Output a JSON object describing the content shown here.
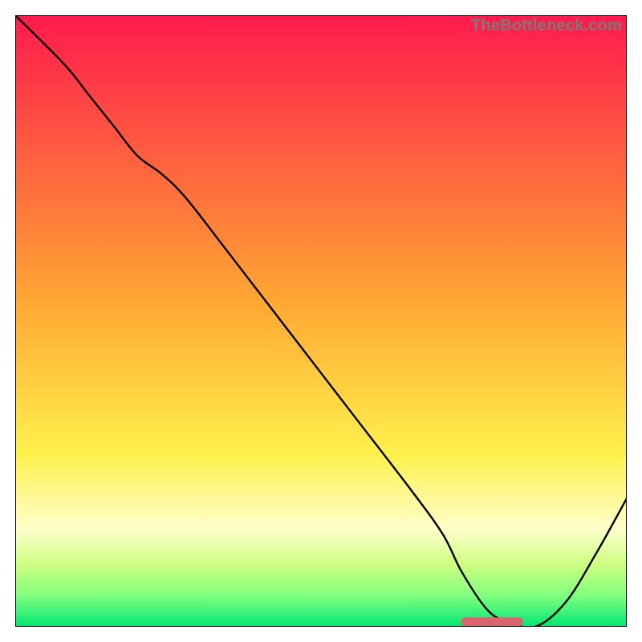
{
  "attribution": "TheBottleneck.com",
  "colors": {
    "red_top": "#ff1a4d",
    "orange_mid": "#ffa733",
    "yellow": "#fff24d",
    "pale_yellow": "#ffffcc",
    "yellow_green": "#ccff80",
    "light_green": "#80ff80",
    "green": "#00e673",
    "curve": "#000000",
    "marker_fill": "#d9656f",
    "marker_stroke": "#d9656f",
    "frame": "#000000",
    "attribution_text": "#7a7a7a"
  },
  "chart_data": {
    "type": "line",
    "title": "",
    "xlabel": "",
    "ylabel": "",
    "xlim": [
      0,
      100
    ],
    "ylim": [
      0,
      100
    ],
    "series": [
      {
        "name": "curve",
        "x": [
          0,
          8,
          12,
          16,
          20,
          24,
          28,
          35,
          45,
          55,
          65,
          70,
          73,
          77,
          80,
          85,
          90,
          95,
          100
        ],
        "y": [
          100,
          92,
          87,
          82,
          77,
          74,
          70,
          61,
          48,
          35,
          22,
          15,
          9,
          3,
          1,
          0,
          4,
          12,
          21
        ]
      }
    ],
    "marker": {
      "x_start": 73,
      "x_end": 83,
      "y": 0.8
    },
    "gradient_stops_percent": [
      {
        "p": 0,
        "c": "red_top"
      },
      {
        "p": 47,
        "c": "orange_mid"
      },
      {
        "p": 72,
        "c": "yellow"
      },
      {
        "p": 84,
        "c": "pale_yellow"
      },
      {
        "p": 90,
        "c": "yellow_green"
      },
      {
        "p": 95,
        "c": "light_green"
      },
      {
        "p": 100,
        "c": "green"
      }
    ]
  }
}
